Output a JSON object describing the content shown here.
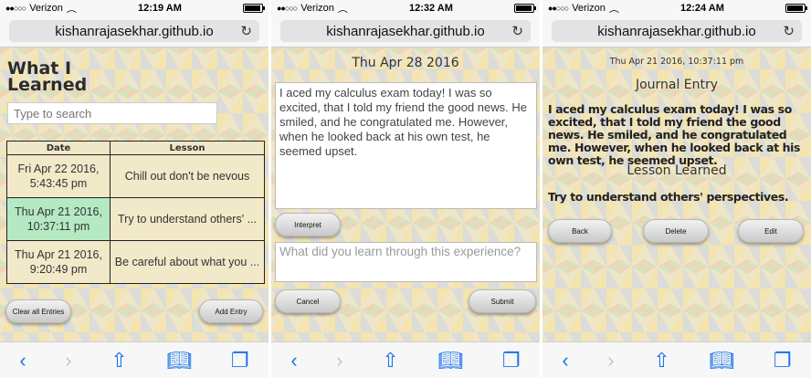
{
  "status": {
    "carrier": "Verizon",
    "signal_dots": "●●○○○",
    "times": [
      "12:19 AM",
      "12:32 AM",
      "12:24 AM"
    ]
  },
  "url": "kishanrajasekhar.github.io",
  "screen1": {
    "title_line1": "What I",
    "title_line2": "Learned",
    "search_placeholder": "Type to search",
    "table": {
      "headers": [
        "Date",
        "Lesson"
      ],
      "rows": [
        {
          "date": "Fri Apr 22 2016, 5:43:45 pm",
          "lesson": "Chill out don't be nevous"
        },
        {
          "date": "Thu Apr 21 2016, 10:37:11 pm",
          "lesson": "Try to understand others' ..."
        },
        {
          "date": "Thu Apr 21 2016, 9:20:49 pm",
          "lesson": "Be careful about what you ..."
        }
      ]
    },
    "clear_label": "Clear all Entries",
    "add_label": "Add Entry"
  },
  "screen2": {
    "date": "Thu Apr 28 2016",
    "entry_text": "I aced my calculus exam today! I was so excited, that I told my friend the good news. He smiled, and he congratulated me. However, when he looked back at his own test, he seemed upset.",
    "interpret_label": "Interpret",
    "learn_placeholder": "What did you learn through this experience?",
    "cancel_label": "Cancel",
    "submit_label": "Submit"
  },
  "screen3": {
    "timestamp": "Thu Apr 21 2016, 10:37:11 pm",
    "journal_heading": "Journal Entry",
    "journal_text": "I aced my calculus exam today! I was so excited, that I told my friend the good news. He smiled, and he congratulated me. However, when he looked back at his own test, he seemed upset.",
    "lesson_heading": "Lesson Learned",
    "lesson_text": "Try to understand others' perspectives.",
    "back_label": "Back",
    "delete_label": "Delete",
    "edit_label": "Edit"
  },
  "toolbar_icons": [
    "back-icon",
    "forward-icon",
    "share-icon",
    "bookmarks-icon",
    "tabs-icon"
  ],
  "colors": {
    "ios_blue": "#1a73e8",
    "selected_row": "#b4e9c3"
  }
}
